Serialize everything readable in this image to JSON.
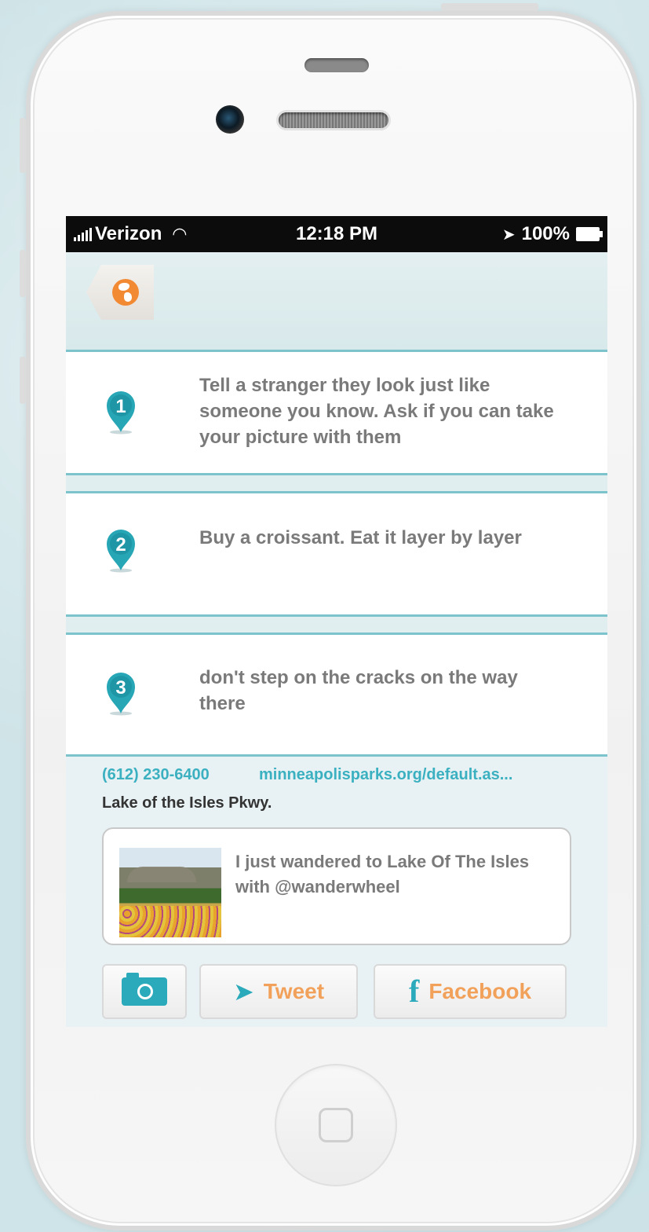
{
  "status_bar": {
    "carrier": "Verizon",
    "time": "12:18 PM",
    "battery": "100%"
  },
  "tasks": [
    {
      "number": "1",
      "text": "Tell a stranger they look just like someone you know. Ask if you can take your picture with them"
    },
    {
      "number": "2",
      "text": "Buy a croissant. Eat it layer by layer"
    },
    {
      "number": "3",
      "text": "don't step on the cracks on the way there"
    }
  ],
  "place": {
    "phone": "(612) 230-6400",
    "website": "minneapolisparks.org/default.as...",
    "address": "Lake of the Isles Pkwy."
  },
  "share": {
    "message": "I just wandered to Lake Of The Isles with @wanderwheel",
    "tweet_label": "Tweet",
    "facebook_label": "Facebook"
  },
  "colors": {
    "accent_teal": "#2aaabb",
    "accent_orange": "#f2a15a",
    "globe_orange": "#f28a33",
    "card_border": "#7cc3cc"
  },
  "icons": [
    "globe-icon",
    "location-pin-icon",
    "camera-icon",
    "twitter-bird-icon",
    "facebook-icon",
    "wifi-icon",
    "location-arrow-icon",
    "battery-icon"
  ]
}
